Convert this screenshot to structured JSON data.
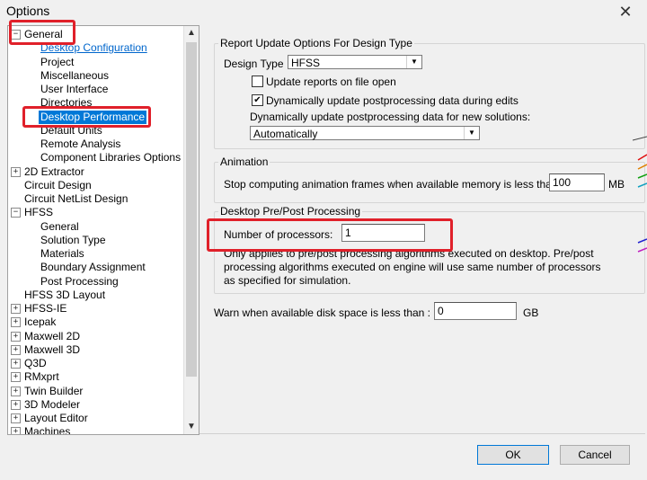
{
  "window": {
    "title": "Options",
    "close_glyph": "✕"
  },
  "tree": {
    "items": [
      {
        "label": "General",
        "expander": "−",
        "level": 0
      },
      {
        "label": "Desktop Configuration",
        "level": 1,
        "style": "link"
      },
      {
        "label": "Project",
        "level": 1
      },
      {
        "label": "Miscellaneous",
        "level": 1
      },
      {
        "label": "User Interface",
        "level": 1
      },
      {
        "label": "Directories",
        "level": 1
      },
      {
        "label": "Desktop Performance",
        "level": 1,
        "style": "selected"
      },
      {
        "label": "Default Units",
        "level": 1
      },
      {
        "label": "Remote Analysis",
        "level": 1
      },
      {
        "label": "Component Libraries Options",
        "level": 1
      },
      {
        "label": "2D Extractor",
        "expander": "+",
        "level": 0
      },
      {
        "label": "Circuit Design",
        "level": 0
      },
      {
        "label": "Circuit NetList Design",
        "level": 0
      },
      {
        "label": "HFSS",
        "expander": "−",
        "level": 0
      },
      {
        "label": "General",
        "level": 1
      },
      {
        "label": "Solution Type",
        "level": 1
      },
      {
        "label": "Materials",
        "level": 1
      },
      {
        "label": "Boundary Assignment",
        "level": 1
      },
      {
        "label": "Post Processing",
        "level": 1
      },
      {
        "label": "HFSS 3D Layout",
        "level": 0
      },
      {
        "label": "HFSS-IE",
        "expander": "+",
        "level": 0
      },
      {
        "label": "Icepak",
        "expander": "+",
        "level": 0
      },
      {
        "label": "Maxwell 2D",
        "expander": "+",
        "level": 0
      },
      {
        "label": "Maxwell 3D",
        "expander": "+",
        "level": 0
      },
      {
        "label": "Q3D",
        "expander": "+",
        "level": 0
      },
      {
        "label": "RMxprt",
        "expander": "+",
        "level": 0
      },
      {
        "label": "Twin Builder",
        "expander": "+",
        "level": 0
      },
      {
        "label": "3D Modeler",
        "expander": "+",
        "level": 0
      },
      {
        "label": "Layout Editor",
        "expander": "+",
        "level": 0
      },
      {
        "label": "Machines",
        "expander": "+",
        "level": 0
      }
    ],
    "scroll_up": "▲",
    "scroll_down": "▼"
  },
  "report_update": {
    "legend": "Report Update Options For Design Type",
    "design_type_label": "Design Type",
    "design_type_value": "HFSS",
    "update_on_open_label": "Update reports on file open",
    "update_on_open_checked": false,
    "dynamic_update_label": "Dynamically update postprocessing data during edits",
    "dynamic_update_checked": true,
    "new_solutions_label": "Dynamically update postprocessing data for new solutions:",
    "new_solutions_value": "Automatically",
    "check_glyph": "✔",
    "dropdown_glyph": "▼"
  },
  "animation": {
    "legend": "Animation",
    "stop_label": "Stop computing animation frames when available memory is less than:",
    "value": "100",
    "unit": "MB"
  },
  "pre_post": {
    "legend": "Desktop Pre/Post Processing",
    "processors_label": "Number of processors:",
    "processors_value": "1",
    "note_line1": "Only applies to pre/post processing algorithms executed on desktop. Pre/post",
    "note_line2": "processing algorithms executed on engine will use same number of processors",
    "note_line3": "as specified for simulation."
  },
  "disk": {
    "label": "Warn when available disk space is less than :",
    "value": "0",
    "unit": "GB"
  },
  "buttons": {
    "ok": "OK",
    "cancel": "Cancel"
  },
  "colors": {
    "highlight_red": "#e0202a",
    "selection_blue": "#0078d7",
    "link_blue": "#0066cc"
  }
}
